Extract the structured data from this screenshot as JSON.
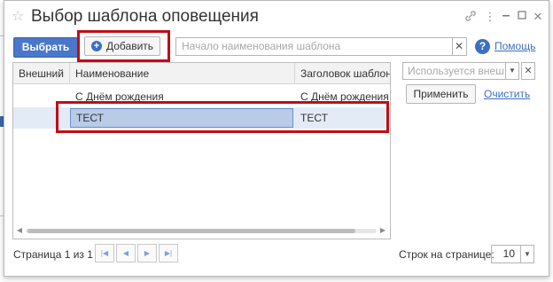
{
  "window": {
    "title": "Выбор шаблона оповещения",
    "controls": {
      "link_icon": "link-icon",
      "menu_icon": "more-icon",
      "minimize_icon": "minimize-icon",
      "maximize_icon": "maximize-icon",
      "close_icon": "close-icon"
    }
  },
  "toolbar": {
    "select_label": "Выбрать",
    "add_label": "Добавить",
    "search_placeholder": "Начало наименования шаблона",
    "help_label": "Помощь"
  },
  "table": {
    "columns": [
      "Внешний",
      "Наименование",
      "Заголовок шаблона"
    ],
    "rows": [
      {
        "external": "",
        "name": "С Днём рождения",
        "header": "С Днём рождения"
      },
      {
        "external": "",
        "name": "ТЕСТ",
        "header": "ТЕСТ",
        "selected": true
      }
    ]
  },
  "filter": {
    "placeholder": "Используется внеш...",
    "apply_label": "Применить",
    "clear_label": "Очистить"
  },
  "pager": {
    "page_text": "Страница 1 из 1",
    "rows_per_page_label": "Строк на странице:",
    "rows_per_page_value": "10"
  },
  "colors": {
    "accent": "#4a77c9",
    "highlight": "#c00d16",
    "selection": "#e3ebf7"
  }
}
